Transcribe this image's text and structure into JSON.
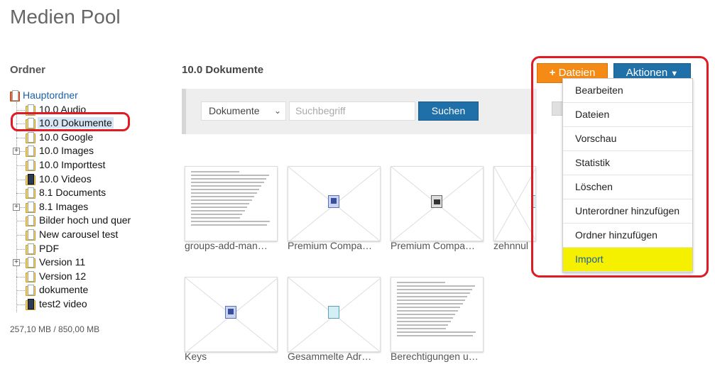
{
  "page_title": "Medien Pool",
  "sidebar": {
    "heading": "Ordner",
    "root": "Hauptordner",
    "items": [
      {
        "label": "10.0 Audio",
        "expand": false,
        "icon": "folder"
      },
      {
        "label": "10.0 Dokumente",
        "expand": false,
        "icon": "folder",
        "selected": true
      },
      {
        "label": "10.0 Google",
        "expand": false,
        "icon": "folder"
      },
      {
        "label": "10.0 Images",
        "expand": true,
        "icon": "folder"
      },
      {
        "label": "10.0 Importtest",
        "expand": false,
        "icon": "folder"
      },
      {
        "label": "10.0 Videos",
        "expand": false,
        "icon": "video-folder"
      },
      {
        "label": "8.1 Documents",
        "expand": false,
        "icon": "folder"
      },
      {
        "label": "8.1 Images",
        "expand": true,
        "icon": "folder"
      },
      {
        "label": "Bilder hoch und quer",
        "expand": false,
        "icon": "folder"
      },
      {
        "label": "New carousel test",
        "expand": false,
        "icon": "folder"
      },
      {
        "label": "PDF",
        "expand": false,
        "icon": "folder"
      },
      {
        "label": "Version 11",
        "expand": true,
        "icon": "folder"
      },
      {
        "label": "Version 12",
        "expand": false,
        "icon": "folder"
      },
      {
        "label": "dokumente",
        "expand": false,
        "icon": "folder"
      },
      {
        "label": "test2 video",
        "expand": false,
        "icon": "video-folder"
      }
    ],
    "quota": "257,10 MB / 850,00 MB"
  },
  "main": {
    "section_title": "10.0 Dokumente",
    "search": {
      "select_value": "Dokumente",
      "placeholder": "Suchbegriff",
      "button": "Suchen"
    },
    "files": [
      {
        "label": "groups-add-man…",
        "type": "document-preview"
      },
      {
        "label": "Premium Compa…",
        "type": "word"
      },
      {
        "label": "Premium Compa…",
        "type": "presentation"
      },
      {
        "label": "zehnnul",
        "type": "sheet"
      },
      {
        "label": "Keys",
        "type": "word"
      },
      {
        "label": "Gesammelte Adr…",
        "type": "sheet"
      },
      {
        "label": "Berechtigungen u…",
        "type": "text-preview"
      }
    ]
  },
  "actions": {
    "dateien_button": "Dateien",
    "aktionen_button": "Aktionen",
    "menu": [
      "Bearbeiten",
      "Dateien",
      "Vorschau",
      "Statistik",
      "Löschen",
      "Unterordner hinzufügen",
      "Ordner hinzufügen",
      "Import"
    ],
    "highlighted_item": "Import",
    "colors": {
      "accent_orange": "#f58a14",
      "accent_blue": "#1f6fa8",
      "highlight_yellow": "#f5f000",
      "annotation_red": "#e01b24"
    }
  }
}
